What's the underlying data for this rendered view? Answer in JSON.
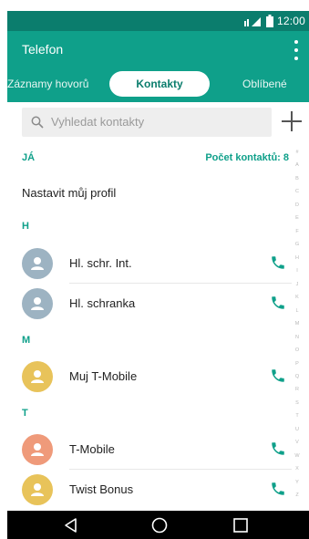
{
  "status_bar": {
    "time": "12:00",
    "icons": [
      "signal-icon",
      "battery-icon"
    ]
  },
  "app_bar": {
    "title": "Telefon",
    "menu_icon": "overflow-menu-icon"
  },
  "tabs": [
    {
      "label": "Záznamy hovorů",
      "selected": false
    },
    {
      "label": "Kontakty",
      "selected": true
    },
    {
      "label": "Oblíbené",
      "selected": false
    }
  ],
  "search": {
    "placeholder": "Vyhledat kontakty",
    "add_icon": "plus-icon"
  },
  "profile_section": {
    "header": "JÁ",
    "count_label": "Počet kontaktů: 8",
    "set_profile": "Nastavit můj profil"
  },
  "sections": [
    {
      "letter": "H",
      "contacts": [
        {
          "name": "Hl. schr. Int.",
          "avatar_color": "#9db3c2"
        },
        {
          "name": "Hl. schranka",
          "avatar_color": "#9db3c2"
        }
      ]
    },
    {
      "letter": "M",
      "contacts": [
        {
          "name": "Muj T-Mobile",
          "avatar_color": "#e8c35a"
        }
      ]
    },
    {
      "letter": "T",
      "contacts": [
        {
          "name": "T-Mobile",
          "avatar_color": "#ef9a7a"
        },
        {
          "name": "Twist Bonus",
          "avatar_color": "#e8c35a"
        }
      ]
    }
  ],
  "index_letters": [
    "#",
    "A",
    "B",
    "C",
    "D",
    "E",
    "F",
    "G",
    "H",
    "I",
    "J",
    "K",
    "L",
    "M",
    "N",
    "O",
    "P",
    "Q",
    "R",
    "S",
    "T",
    "U",
    "V",
    "W",
    "X",
    "Y",
    "Z"
  ],
  "colors": {
    "accent": "#0fa08a",
    "status_bar": "#0b7d6d",
    "call_icon": "#0fa08a"
  },
  "nav_bar": {
    "icons": [
      "back-icon",
      "home-icon",
      "recents-icon"
    ]
  }
}
